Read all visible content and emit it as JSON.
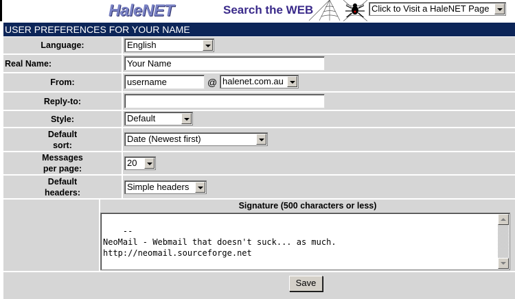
{
  "banner": {
    "logo": "HaleNET",
    "search_text": "Search the WEB",
    "visit_select": "Click to Visit a HaleNET Page"
  },
  "title": "USER PREFERENCES FOR YOUR NAME",
  "fields": {
    "language": {
      "label": "Language:",
      "value": "English"
    },
    "realname": {
      "label": "Real Name:",
      "value": "Your Name"
    },
    "from": {
      "label": "From:",
      "user": "username",
      "at": "@",
      "domain": "halenet.com.au"
    },
    "replyto": {
      "label": "Reply-to:",
      "value": ""
    },
    "style": {
      "label": "Style:",
      "value": "Default"
    },
    "sort": {
      "label_1": "Default",
      "label_2": "sort:",
      "value": "Date (Newest first)"
    },
    "perpage": {
      "label_1": "Messages",
      "label_2": "per page:",
      "value": "20"
    },
    "headers": {
      "label_1": "Default",
      "label_2": "headers:",
      "value": "Simple headers"
    }
  },
  "signature": {
    "title": "Signature (500 characters or less)",
    "text": "--\nNeoMail - Webmail that doesn't suck... as much.\nhttp://neomail.sourceforge.net"
  },
  "save_label": "Save",
  "colors": {
    "title_bg": "#0c2558",
    "cell_bg": "#d6d6d6",
    "logo": "#7a82c4",
    "search_text": "#3a2a8a"
  }
}
